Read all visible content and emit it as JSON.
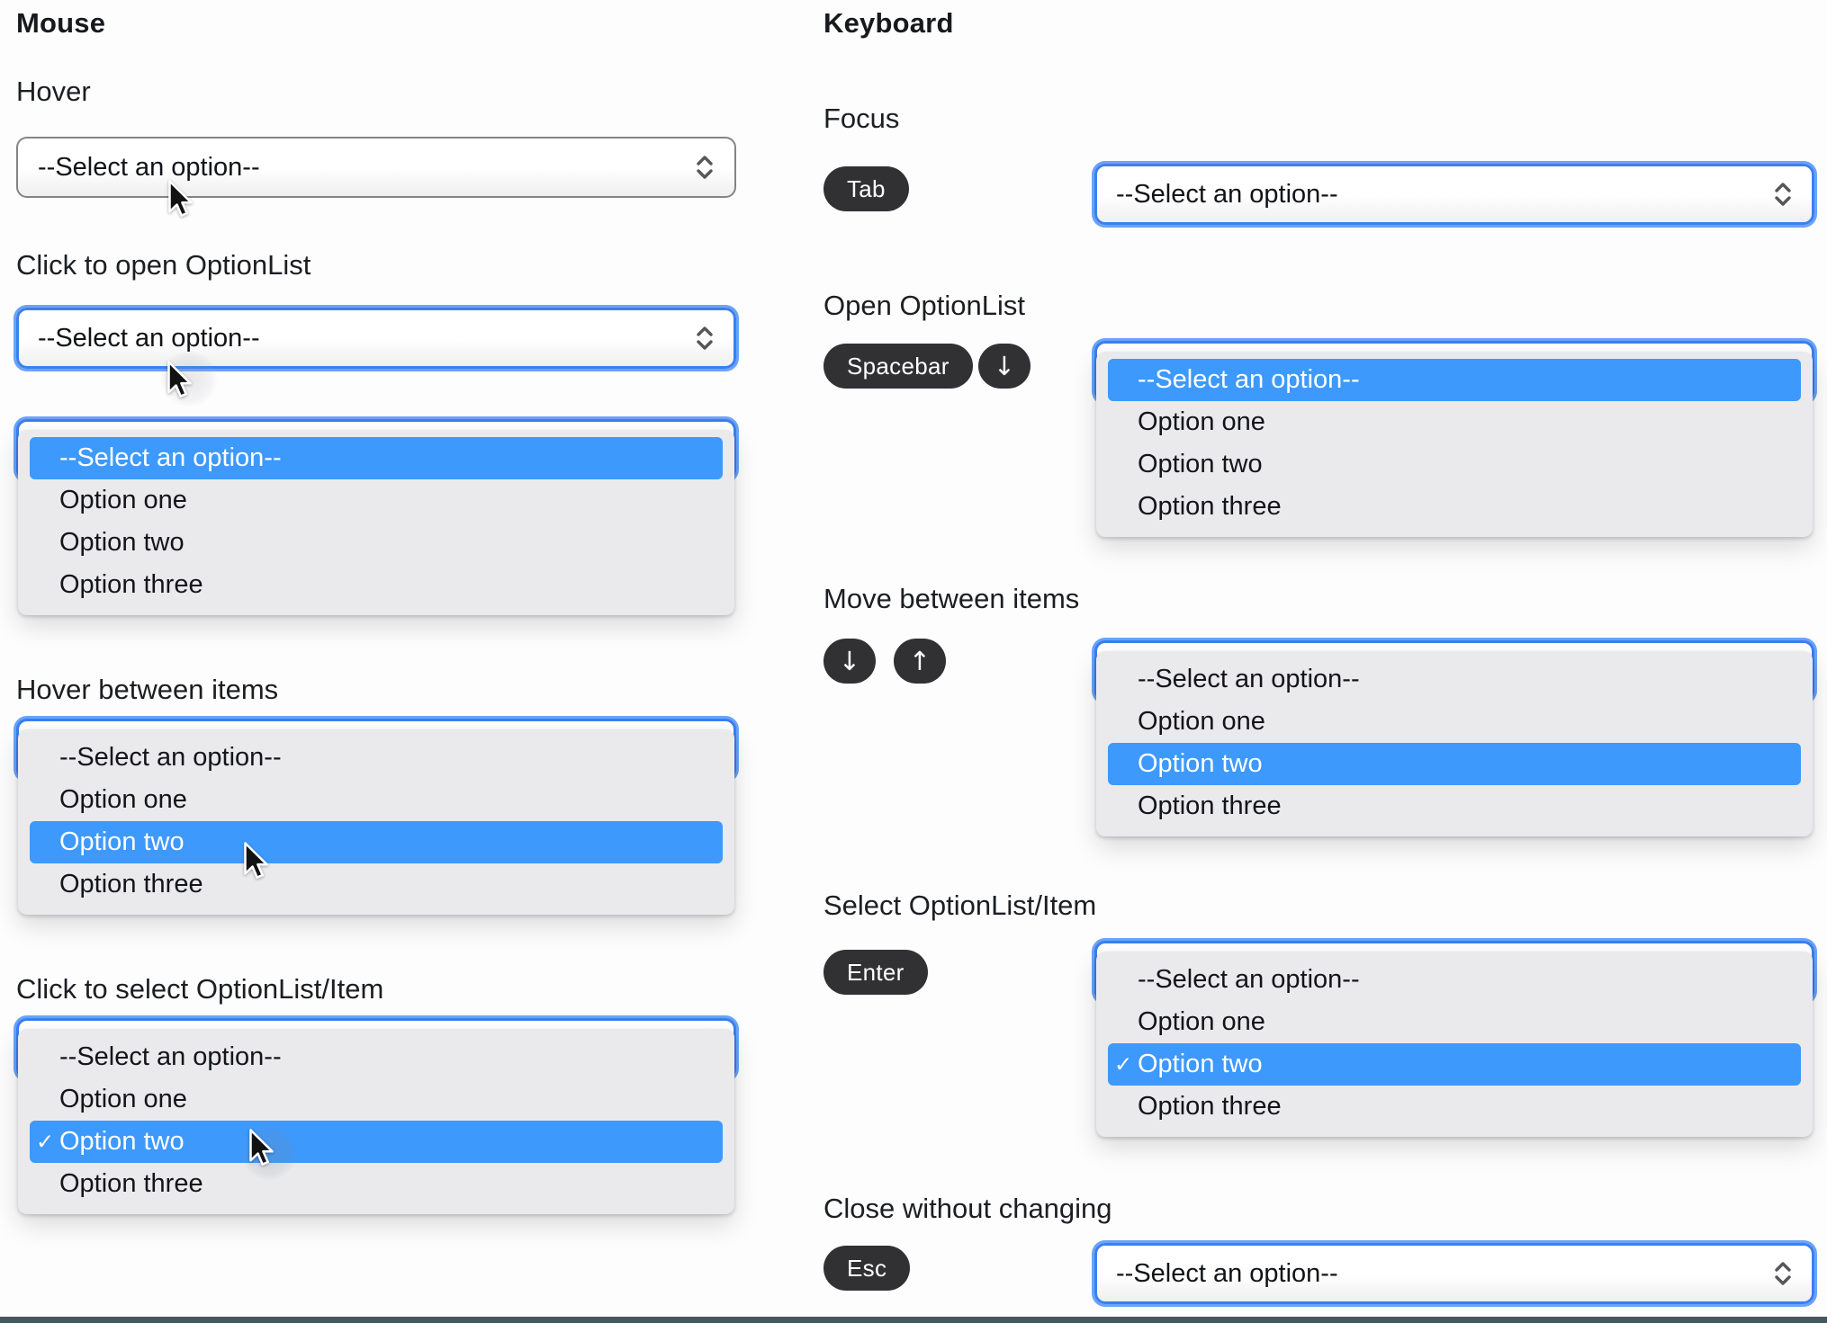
{
  "mouse": {
    "title": "Mouse",
    "sections": {
      "hover": "Hover",
      "click_open": "Click to open OptionList",
      "hover_between": "Hover between items",
      "click_select": "Click to select OptionList/Item"
    }
  },
  "keyboard": {
    "title": "Keyboard",
    "sections": {
      "focus": "Focus",
      "open": "Open OptionList",
      "move": "Move between items",
      "select": "Select OptionList/Item",
      "close": "Close without changing"
    }
  },
  "keys": {
    "tab": "Tab",
    "spacebar": "Spacebar",
    "down": "↓",
    "up": "↑",
    "enter": "Enter",
    "esc": "Esc"
  },
  "select": {
    "placeholder": "--Select an option--"
  },
  "options": {
    "placeholder": "--Select an option--",
    "one": "Option one",
    "two": "Option two",
    "three": "Option three",
    "checkmark": "✓"
  },
  "colors": {
    "focus_ring": "#6aa3f8",
    "focus_border": "#3b7ff0",
    "highlight": "#3d99fc",
    "badge_bg": "#313134",
    "panel_bg": "#eaeaec",
    "bottom_bar": "#44585f"
  }
}
